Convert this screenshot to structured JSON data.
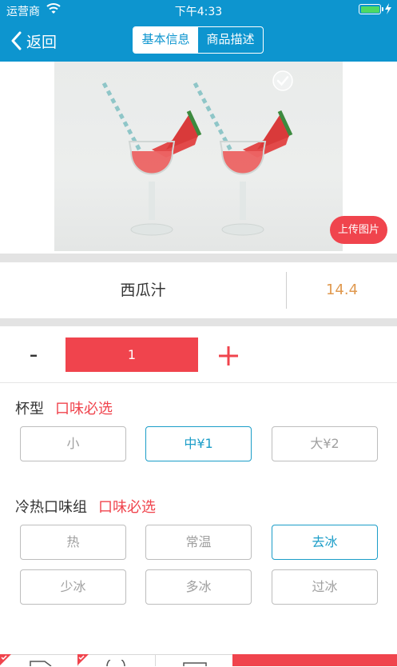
{
  "status_bar": {
    "carrier": "运营商",
    "time": "下午4:33"
  },
  "nav": {
    "back_label": "返回",
    "tabs": [
      {
        "label": "基本信息",
        "active": true
      },
      {
        "label": "商品描述",
        "active": false
      }
    ]
  },
  "product": {
    "upload_label": "上传图片",
    "name": "西瓜汁",
    "price": "14.4",
    "quantity": "1",
    "minus_symbol": "-"
  },
  "sections": [
    {
      "title": "杯型",
      "required_label": "口味必选",
      "options": [
        {
          "label": "小",
          "selected": false
        },
        {
          "label": "中¥1",
          "selected": true
        },
        {
          "label": "大¥2",
          "selected": false
        }
      ]
    },
    {
      "title": "冷热口味组",
      "required_label": "口味必选",
      "options": [
        {
          "label": "热",
          "selected": false
        },
        {
          "label": "常温",
          "selected": false
        },
        {
          "label": "去冰",
          "selected": true
        },
        {
          "label": "少冰",
          "selected": false
        },
        {
          "label": "多冰",
          "selected": false
        },
        {
          "label": "过冰",
          "selected": false
        }
      ]
    }
  ],
  "colors": {
    "header": "#0d95cf",
    "accent_red": "#f0444d",
    "selected_blue": "#1b9dc8",
    "price": "#e0994f"
  }
}
